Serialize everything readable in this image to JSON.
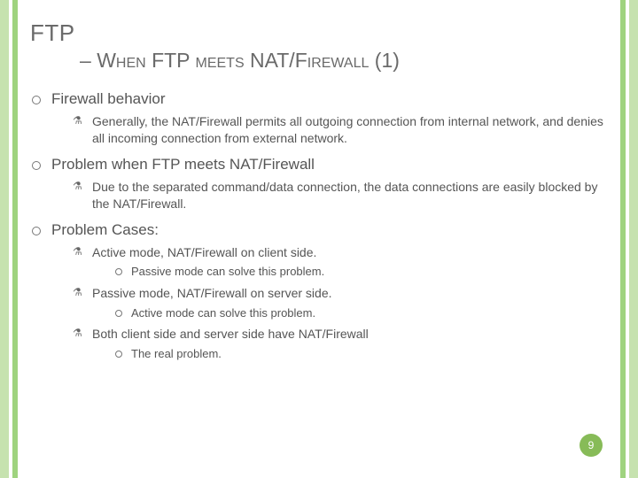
{
  "title": {
    "line1": "FTP",
    "line2_prefix": "– ",
    "line2_word1": "When",
    "line2_mid1": " FTP ",
    "line2_word2": "meets",
    "line2_mid2": " NAT/",
    "line2_word3": "Firewall",
    "line2_suffix": " (1)"
  },
  "b1": {
    "head": "Firewall behavior",
    "p1": "Generally, the NAT/Firewall permits all outgoing connection from internal network, and denies all incoming connection from external network."
  },
  "b2": {
    "head": "Problem when FTP meets NAT/Firewall",
    "p1": "Due to the separated command/data connection, the data connections are easily blocked by the NAT/Firewall."
  },
  "b3": {
    "head": "Problem Cases:",
    "c1": "Active mode, NAT/Firewall on client side.",
    "c1s": "Passive mode can solve this problem.",
    "c2": "Passive mode, NAT/Firewall on server side.",
    "c2s": "Active mode can solve this problem.",
    "c3": "Both client side and server side have NAT/Firewall",
    "c3s": "The real problem."
  },
  "page": "9"
}
